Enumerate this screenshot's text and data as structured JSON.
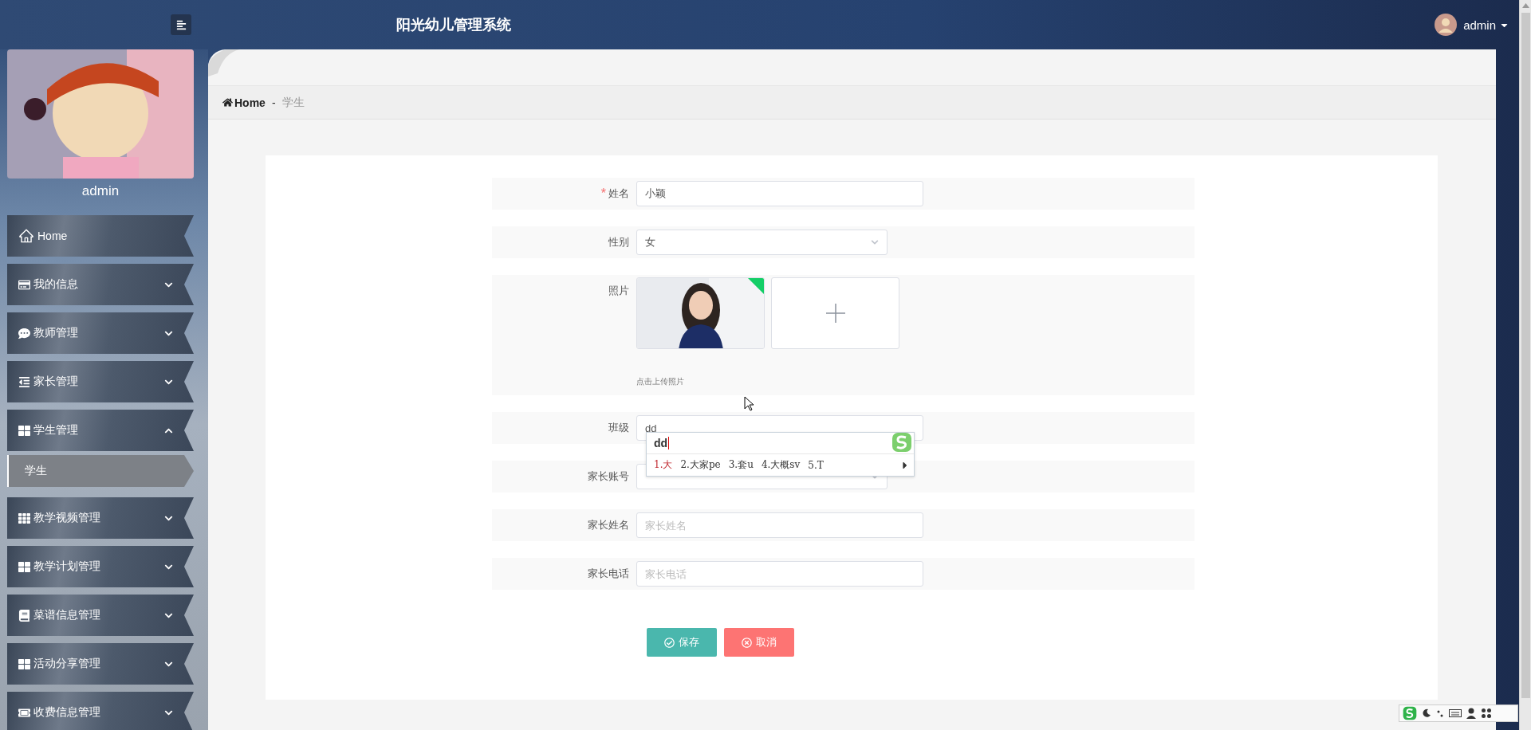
{
  "header": {
    "title": "阳光幼儿管理系统",
    "user": "admin"
  },
  "sidebar": {
    "profile_name": "admin",
    "items": [
      {
        "kind": "link",
        "label": "Home"
      },
      {
        "kind": "group",
        "label": "我的信息",
        "expanded": false
      },
      {
        "kind": "group",
        "label": "教师管理",
        "expanded": false
      },
      {
        "kind": "group",
        "label": "家长管理",
        "expanded": false
      },
      {
        "kind": "group",
        "label": "学生管理",
        "expanded": true,
        "children": [
          {
            "label": "学生",
            "selected": true
          }
        ]
      },
      {
        "kind": "group",
        "label": "教学视频管理",
        "expanded": false
      },
      {
        "kind": "group",
        "label": "教学计划管理",
        "expanded": false
      },
      {
        "kind": "group",
        "label": "菜谱信息管理",
        "expanded": false
      },
      {
        "kind": "group",
        "label": "活动分享管理",
        "expanded": false
      },
      {
        "kind": "group",
        "label": "收费信息管理",
        "expanded": false
      }
    ]
  },
  "breadcrumb": {
    "home": "Home",
    "separator": "-",
    "current": "学生"
  },
  "form": {
    "fields": [
      {
        "kind": "text",
        "label": "姓名",
        "required_mark": "*",
        "value": "小颖"
      },
      {
        "kind": "select",
        "label": "性别",
        "value": "女"
      },
      {
        "label": "照片",
        "uploaded": true,
        "hint": "点击上传照片"
      },
      {
        "kind": "text",
        "label": "班级",
        "value": "dd"
      },
      {
        "kind": "select",
        "label": "家长账号"
      },
      {
        "kind": "text",
        "label": "家长姓名",
        "placeholder": "家长姓名"
      },
      {
        "kind": "text",
        "label": "家长电话",
        "placeholder": "家长电话"
      }
    ],
    "buttons": [
      {
        "kind": "save",
        "label": "保存"
      },
      {
        "kind": "cancel",
        "label": "取消"
      }
    ]
  },
  "ime": {
    "composition": "dd",
    "candidates": [
      {
        "text": "1.大",
        "selected": true
      },
      {
        "text": "2.大家pe",
        "selected": false
      },
      {
        "text": "3.套u",
        "selected": false
      },
      {
        "text": "4.大概sv",
        "selected": false
      },
      {
        "text": "5.T",
        "selected": false
      }
    ]
  }
}
